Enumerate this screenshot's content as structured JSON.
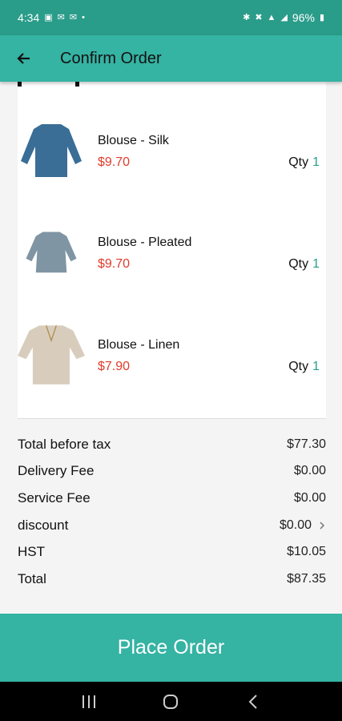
{
  "status_bar": {
    "time": "4:34",
    "battery": "96%",
    "icons": [
      "image-icon",
      "mail-icon",
      "mail-icon",
      "dot-icon",
      "bluetooth-icon",
      "mute-icon",
      "wifi-icon",
      "signal-icon",
      "battery-icon"
    ]
  },
  "app_bar": {
    "title": "Confirm Order",
    "back_icon": "back-arrow-icon"
  },
  "items": [
    {
      "name": "Blouse - Silk",
      "price": "$9.70",
      "qty_label": "Qty",
      "qty": "1",
      "color": "#3a6e96"
    },
    {
      "name": "Blouse - Pleated",
      "price": "$9.70",
      "qty_label": "Qty",
      "qty": "1",
      "color": "#7f95a4"
    },
    {
      "name": "Blouse - Linen",
      "price": "$7.90",
      "qty_label": "Qty",
      "qty": "1",
      "color": "#d8cdbd"
    }
  ],
  "totals": {
    "before_tax_label": "Total before tax",
    "before_tax": "$77.30",
    "delivery_label": "Delivery Fee",
    "delivery": "$0.00",
    "service_label": "Service Fee",
    "service": "$0.00",
    "discount_label": "discount",
    "discount": "$0.00",
    "hst_label": "HST",
    "hst": "$10.05",
    "total_label": "Total",
    "total": "$87.35"
  },
  "place_order_label": "Place Order",
  "colors": {
    "status_bar": "#2a9c8a",
    "accent": "#35b3a3",
    "price": "#e23b2a",
    "qty": "#2a9c8a"
  }
}
